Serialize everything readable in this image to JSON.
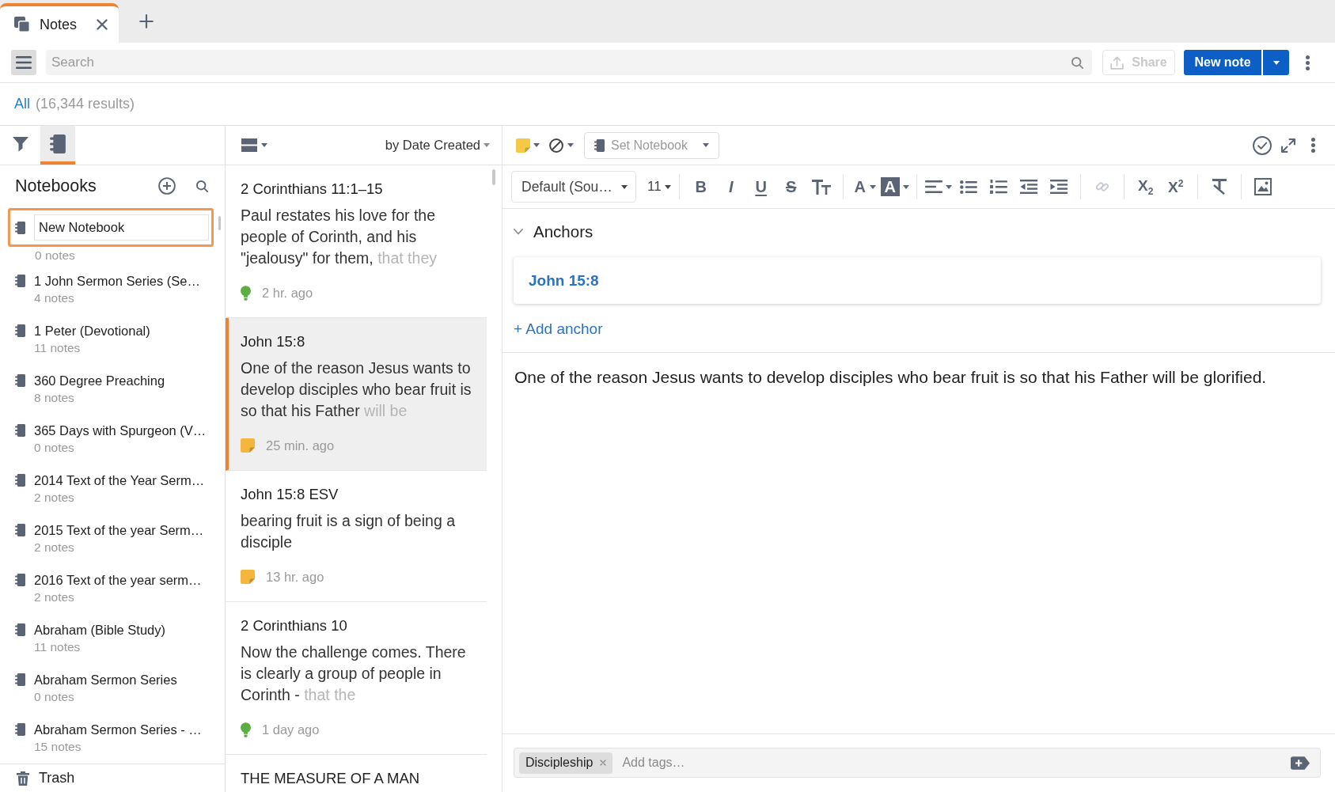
{
  "tabs": [
    {
      "label": "Notes",
      "selected": true
    }
  ],
  "toolbar": {
    "search": {
      "placeholder": "Search"
    },
    "share": {
      "label": "Share",
      "disabled": true
    },
    "new_note": {
      "label": "New note"
    }
  },
  "results": {
    "scope": "All",
    "count": "(16,344 results)"
  },
  "sidebar": {
    "tabs": [
      {
        "kind": "filter",
        "selected": false
      },
      {
        "kind": "notebooks",
        "selected": true
      }
    ],
    "title": "Notebooks",
    "notebooks": [
      {
        "name": "New Notebook",
        "count": "0 notes",
        "editing": true
      },
      {
        "name": "1 John Sermon Series (Se…",
        "count": "4 notes",
        "editing": false
      },
      {
        "name": "1 Peter (Devotional)",
        "count": "11 notes",
        "editing": false
      },
      {
        "name": "360 Degree Preaching",
        "count": "8 notes",
        "editing": false
      },
      {
        "name": "365 Days with Spurgeon (V…",
        "count": "0 notes",
        "editing": false
      },
      {
        "name": "2014 Text of the Year Serm…",
        "count": "2 notes",
        "editing": false
      },
      {
        "name": "2015 Text of the year Serm…",
        "count": "2 notes",
        "editing": false
      },
      {
        "name": "2016 Text of the year serm…",
        "count": "2 notes",
        "editing": false
      },
      {
        "name": "Abraham (Bible Study)",
        "count": "11 notes",
        "editing": false
      },
      {
        "name": "Abraham Sermon Series",
        "count": "0 notes",
        "editing": false
      },
      {
        "name": "Abraham Sermon Series - …",
        "count": "15 notes",
        "editing": false
      }
    ],
    "trash": "Trash"
  },
  "note_list": {
    "sort": "by Date Created",
    "notes": [
      {
        "title": "2 Corinthians 11:1–15",
        "preview": "Paul restates his love for the people of Corinth, and his \"jealousy\" for them,",
        "preview_faded": "that they",
        "kind": "bulb",
        "time": "2 hr. ago",
        "selected": false
      },
      {
        "title": "John 15:8",
        "preview": "One of the reason Jesus wants to develop disciples who bear fruit is so that his Father",
        "preview_faded": "will be",
        "kind": "sticky",
        "time": "25 min. ago",
        "selected": true
      },
      {
        "title": "John 15:8 ESV",
        "preview": "bearing fruit is a sign of being a disciple",
        "kind": "sticky",
        "time": "13 hr. ago",
        "selected": false
      },
      {
        "title": "2 Corinthians 10",
        "preview": "Now the challenge comes. There is clearly a group of people in Corinth -",
        "preview_faded": "that the",
        "kind": "bulb",
        "time": "1 day ago",
        "selected": false
      },
      {
        "title": "THE MEASURE OF A MAN",
        "selected": false
      }
    ]
  },
  "editor": {
    "set_notebook": {
      "label": "Set Notebook"
    },
    "format": {
      "font": "Default (Sou…",
      "size": "11",
      "groups": [
        [
          {
            "kind": "bold",
            "label": "B",
            "disabled": false
          },
          {
            "kind": "italic",
            "label": "I",
            "disabled": false
          },
          {
            "kind": "underline",
            "label": "U",
            "disabled": false
          },
          {
            "kind": "strike",
            "label": "S",
            "disabled": false
          },
          {
            "kind": "text_size",
            "disabled": false
          }
        ],
        [
          {
            "kind": "font_color",
            "label": "A",
            "disabled": false
          },
          {
            "kind": "highlight",
            "label": "A",
            "disabled": false
          }
        ],
        [
          {
            "kind": "align",
            "disabled": false
          },
          {
            "kind": "bullets",
            "disabled": false
          },
          {
            "kind": "numbering",
            "disabled": false
          },
          {
            "kind": "outdent",
            "disabled": false
          },
          {
            "kind": "indent",
            "disabled": false
          }
        ],
        [
          {
            "kind": "link",
            "disabled": true
          }
        ],
        [
          {
            "kind": "subscript",
            "label": "X$_{2}$",
            "disabled": false
          },
          {
            "kind": "superscript",
            "label": "X$^{2}$",
            "disabled": false
          }
        ],
        [
          {
            "kind": "clear",
            "disabled": false
          }
        ],
        [
          {
            "kind": "image",
            "disabled": false
          }
        ]
      ]
    },
    "anchors": {
      "title": "Anchors",
      "expanded": true,
      "items": [
        "John 15:8"
      ],
      "add": "+ Add anchor"
    },
    "body": "One of the reason Jesus wants to develop disciples who bear fruit is so that his Father will be glorified.",
    "tags": {
      "items": [
        "Discipleship"
      ],
      "placeholder": "Add tags…"
    }
  }
}
